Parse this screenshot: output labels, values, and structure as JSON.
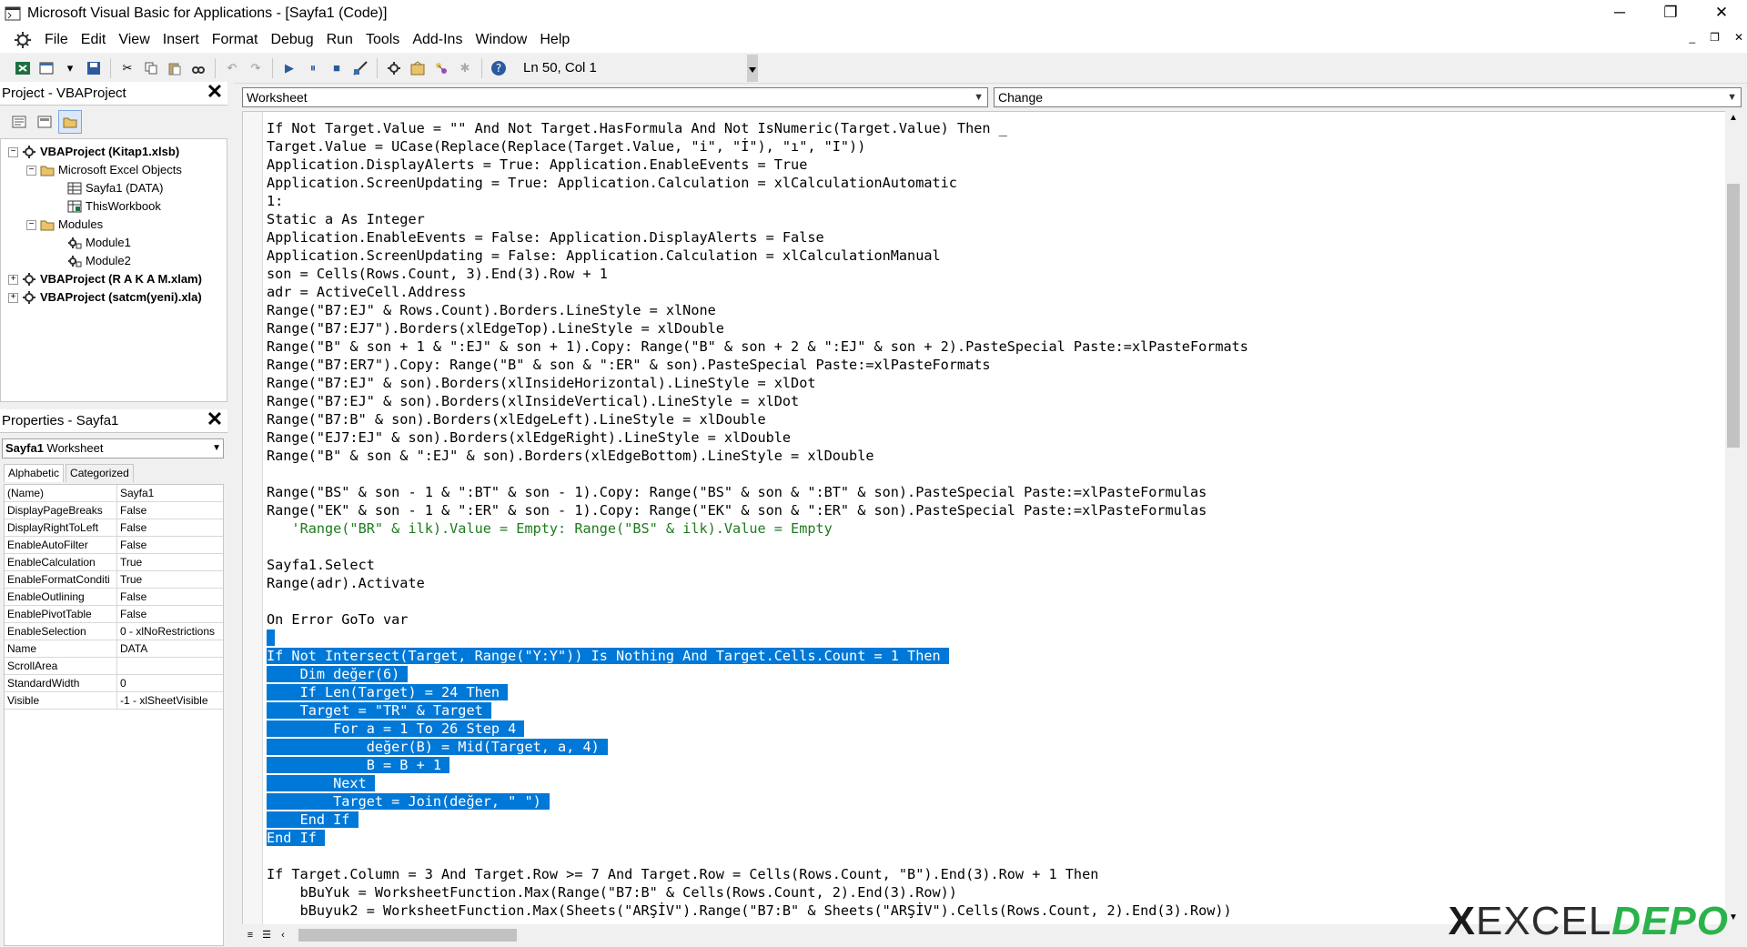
{
  "window": {
    "title": "Microsoft Visual Basic for Applications - [Sayfa1 (Code)]",
    "controls": [
      "─",
      "❐",
      "✕"
    ]
  },
  "menu": [
    "File",
    "Edit",
    "View",
    "Insert",
    "Format",
    "Debug",
    "Run",
    "Tools",
    "Add-Ins",
    "Window",
    "Help"
  ],
  "mdi_controls": [
    "_",
    "❐",
    "✕"
  ],
  "toolbar": {
    "status": "Ln 50, Col 1"
  },
  "project_explorer": {
    "title": "Project - VBAProject",
    "close": "✕",
    "tree": [
      {
        "label": "VBAProject (Kitap1.xlsb)",
        "bold": true,
        "toggle": "−",
        "icon": "vba-project-icon"
      },
      {
        "label": "Microsoft Excel Objects",
        "bold": false,
        "toggle": "−",
        "icon": "folder-icon"
      },
      {
        "label": "Sayfa1 (DATA)",
        "bold": false,
        "toggle": "",
        "icon": "worksheet-icon"
      },
      {
        "label": "ThisWorkbook",
        "bold": false,
        "toggle": "",
        "icon": "workbook-icon"
      },
      {
        "label": "Modules",
        "bold": false,
        "toggle": "−",
        "icon": "folder-icon"
      },
      {
        "label": "Module1",
        "bold": false,
        "toggle": "",
        "icon": "module-icon"
      },
      {
        "label": "Module2",
        "bold": false,
        "toggle": "",
        "icon": "module-icon"
      },
      {
        "label": "VBAProject (R A K A M.xlam)",
        "bold": true,
        "toggle": "+",
        "icon": "vba-project-icon"
      },
      {
        "label": "VBAProject (satcm(yeni).xla)",
        "bold": true,
        "toggle": "+",
        "icon": "vba-project-icon"
      }
    ]
  },
  "properties": {
    "title": "Properties - Sayfa1",
    "close": "✕",
    "object_name": "Sayfa1",
    "object_type": "Worksheet",
    "tabs": [
      "Alphabetic",
      "Categorized"
    ],
    "rows": [
      {
        "name": "(Name)",
        "value": "Sayfa1"
      },
      {
        "name": "DisplayPageBreaks",
        "value": "False"
      },
      {
        "name": "DisplayRightToLeft",
        "value": "False"
      },
      {
        "name": "EnableAutoFilter",
        "value": "False"
      },
      {
        "name": "EnableCalculation",
        "value": "True"
      },
      {
        "name": "EnableFormatConditi",
        "value": "True"
      },
      {
        "name": "EnableOutlining",
        "value": "False"
      },
      {
        "name": "EnablePivotTable",
        "value": "False"
      },
      {
        "name": "EnableSelection",
        "value": "0 - xlNoRestrictions"
      },
      {
        "name": "Name",
        "value": "DATA"
      },
      {
        "name": "ScrollArea",
        "value": ""
      },
      {
        "name": "StandardWidth",
        "value": "0"
      },
      {
        "name": "Visible",
        "value": "-1 - xlSheetVisible"
      }
    ]
  },
  "code_window": {
    "object_combo": "Worksheet",
    "procedure_combo": "Change",
    "selection_color": "#0078d7",
    "comment_color": "#1e7b1e",
    "lines": [
      {
        "text": "If Not Target.Value = \"\" And Not Target.HasFormula And Not IsNumeric(Target.Value) Then _",
        "sel": false,
        "comment": false
      },
      {
        "text": "Target.Value = UCase(Replace(Replace(Target.Value, \"i\", \"İ\"), \"ı\", \"I\"))",
        "sel": false,
        "comment": false
      },
      {
        "text": "Application.DisplayAlerts = True: Application.EnableEvents = True",
        "sel": false,
        "comment": false
      },
      {
        "text": "Application.ScreenUpdating = True: Application.Calculation = xlCalculationAutomatic",
        "sel": false,
        "comment": false
      },
      {
        "text": "1:",
        "sel": false,
        "comment": false
      },
      {
        "text": "Static a As Integer",
        "sel": false,
        "comment": false
      },
      {
        "text": "Application.EnableEvents = False: Application.DisplayAlerts = False",
        "sel": false,
        "comment": false
      },
      {
        "text": "Application.ScreenUpdating = False: Application.Calculation = xlCalculationManual",
        "sel": false,
        "comment": false
      },
      {
        "text": "son = Cells(Rows.Count, 3).End(3).Row + 1",
        "sel": false,
        "comment": false
      },
      {
        "text": "adr = ActiveCell.Address",
        "sel": false,
        "comment": false
      },
      {
        "text": "Range(\"B7:EJ\" & Rows.Count).Borders.LineStyle = xlNone",
        "sel": false,
        "comment": false
      },
      {
        "text": "Range(\"B7:EJ7\").Borders(xlEdgeTop).LineStyle = xlDouble",
        "sel": false,
        "comment": false
      },
      {
        "text": "Range(\"B\" & son + 1 & \":EJ\" & son + 1).Copy: Range(\"B\" & son + 2 & \":EJ\" & son + 2).PasteSpecial Paste:=xlPasteFormats",
        "sel": false,
        "comment": false
      },
      {
        "text": "Range(\"B7:ER7\").Copy: Range(\"B\" & son & \":ER\" & son).PasteSpecial Paste:=xlPasteFormats",
        "sel": false,
        "comment": false
      },
      {
        "text": "Range(\"B7:EJ\" & son).Borders(xlInsideHorizontal).LineStyle = xlDot",
        "sel": false,
        "comment": false
      },
      {
        "text": "Range(\"B7:EJ\" & son).Borders(xlInsideVertical).LineStyle = xlDot",
        "sel": false,
        "comment": false
      },
      {
        "text": "Range(\"B7:B\" & son).Borders(xlEdgeLeft).LineStyle = xlDouble",
        "sel": false,
        "comment": false
      },
      {
        "text": "Range(\"EJ7:EJ\" & son).Borders(xlEdgeRight).LineStyle = xlDouble",
        "sel": false,
        "comment": false
      },
      {
        "text": "Range(\"B\" & son & \":EJ\" & son).Borders(xlEdgeBottom).LineStyle = xlDouble",
        "sel": false,
        "comment": false
      },
      {
        "text": "",
        "sel": false,
        "comment": false
      },
      {
        "text": "Range(\"BS\" & son - 1 & \":BT\" & son - 1).Copy: Range(\"BS\" & son & \":BT\" & son).PasteSpecial Paste:=xlPasteFormulas",
        "sel": false,
        "comment": false
      },
      {
        "text": "Range(\"EK\" & son - 1 & \":ER\" & son - 1).Copy: Range(\"EK\" & son & \":ER\" & son).PasteSpecial Paste:=xlPasteFormulas",
        "sel": false,
        "comment": false
      },
      {
        "text": "   'Range(\"BR\" & ilk).Value = Empty: Range(\"BS\" & ilk).Value = Empty",
        "sel": false,
        "comment": true
      },
      {
        "text": "",
        "sel": false,
        "comment": false
      },
      {
        "text": "Sayfa1.Select",
        "sel": false,
        "comment": false
      },
      {
        "text": "Range(adr).Activate",
        "sel": false,
        "comment": false
      },
      {
        "text": "",
        "sel": false,
        "comment": false
      },
      {
        "text": "On Error GoTo var",
        "sel": false,
        "comment": false
      },
      {
        "text": " ",
        "sel": true,
        "comment": false
      },
      {
        "text": "If Not Intersect(Target, Range(\"Y:Y\")) Is Nothing And Target.Cells.Count = 1 Then ",
        "sel": true,
        "comment": false
      },
      {
        "text": "    Dim değer(6) ",
        "sel": true,
        "comment": false
      },
      {
        "text": "    If Len(Target) = 24 Then ",
        "sel": true,
        "comment": false
      },
      {
        "text": "    Target = \"TR\" & Target ",
        "sel": true,
        "comment": false
      },
      {
        "text": "        For a = 1 To 26 Step 4 ",
        "sel": true,
        "comment": false
      },
      {
        "text": "            değer(B) = Mid(Target, a, 4) ",
        "sel": true,
        "comment": false
      },
      {
        "text": "            B = B + 1 ",
        "sel": true,
        "comment": false
      },
      {
        "text": "        Next ",
        "sel": true,
        "comment": false
      },
      {
        "text": "        Target = Join(değer, \" \") ",
        "sel": true,
        "comment": false
      },
      {
        "text": "    End If ",
        "sel": true,
        "comment": false
      },
      {
        "text": "End If ",
        "sel": true,
        "comment": false
      },
      {
        "text": "",
        "sel": false,
        "comment": false
      },
      {
        "text": "If Target.Column = 3 And Target.Row >= 7 And Target.Row = Cells(Rows.Count, \"B\").End(3).Row + 1 Then",
        "sel": false,
        "comment": false
      },
      {
        "text": "    bBuYuk = WorksheetFunction.Max(Range(\"B7:B\" & Cells(Rows.Count, 2).End(3).Row))",
        "sel": false,
        "comment": false
      },
      {
        "text": "    bBuyuk2 = WorksheetFunction.Max(Sheets(\"ARŞİV\").Range(\"B7:B\" & Sheets(\"ARŞİV\").Cells(Rows.Count, 2).End(3).Row))",
        "sel": false,
        "comment": false
      }
    ]
  },
  "watermark": {
    "x": "X",
    "excel": "EXCEL",
    "depo": "DEPO"
  }
}
